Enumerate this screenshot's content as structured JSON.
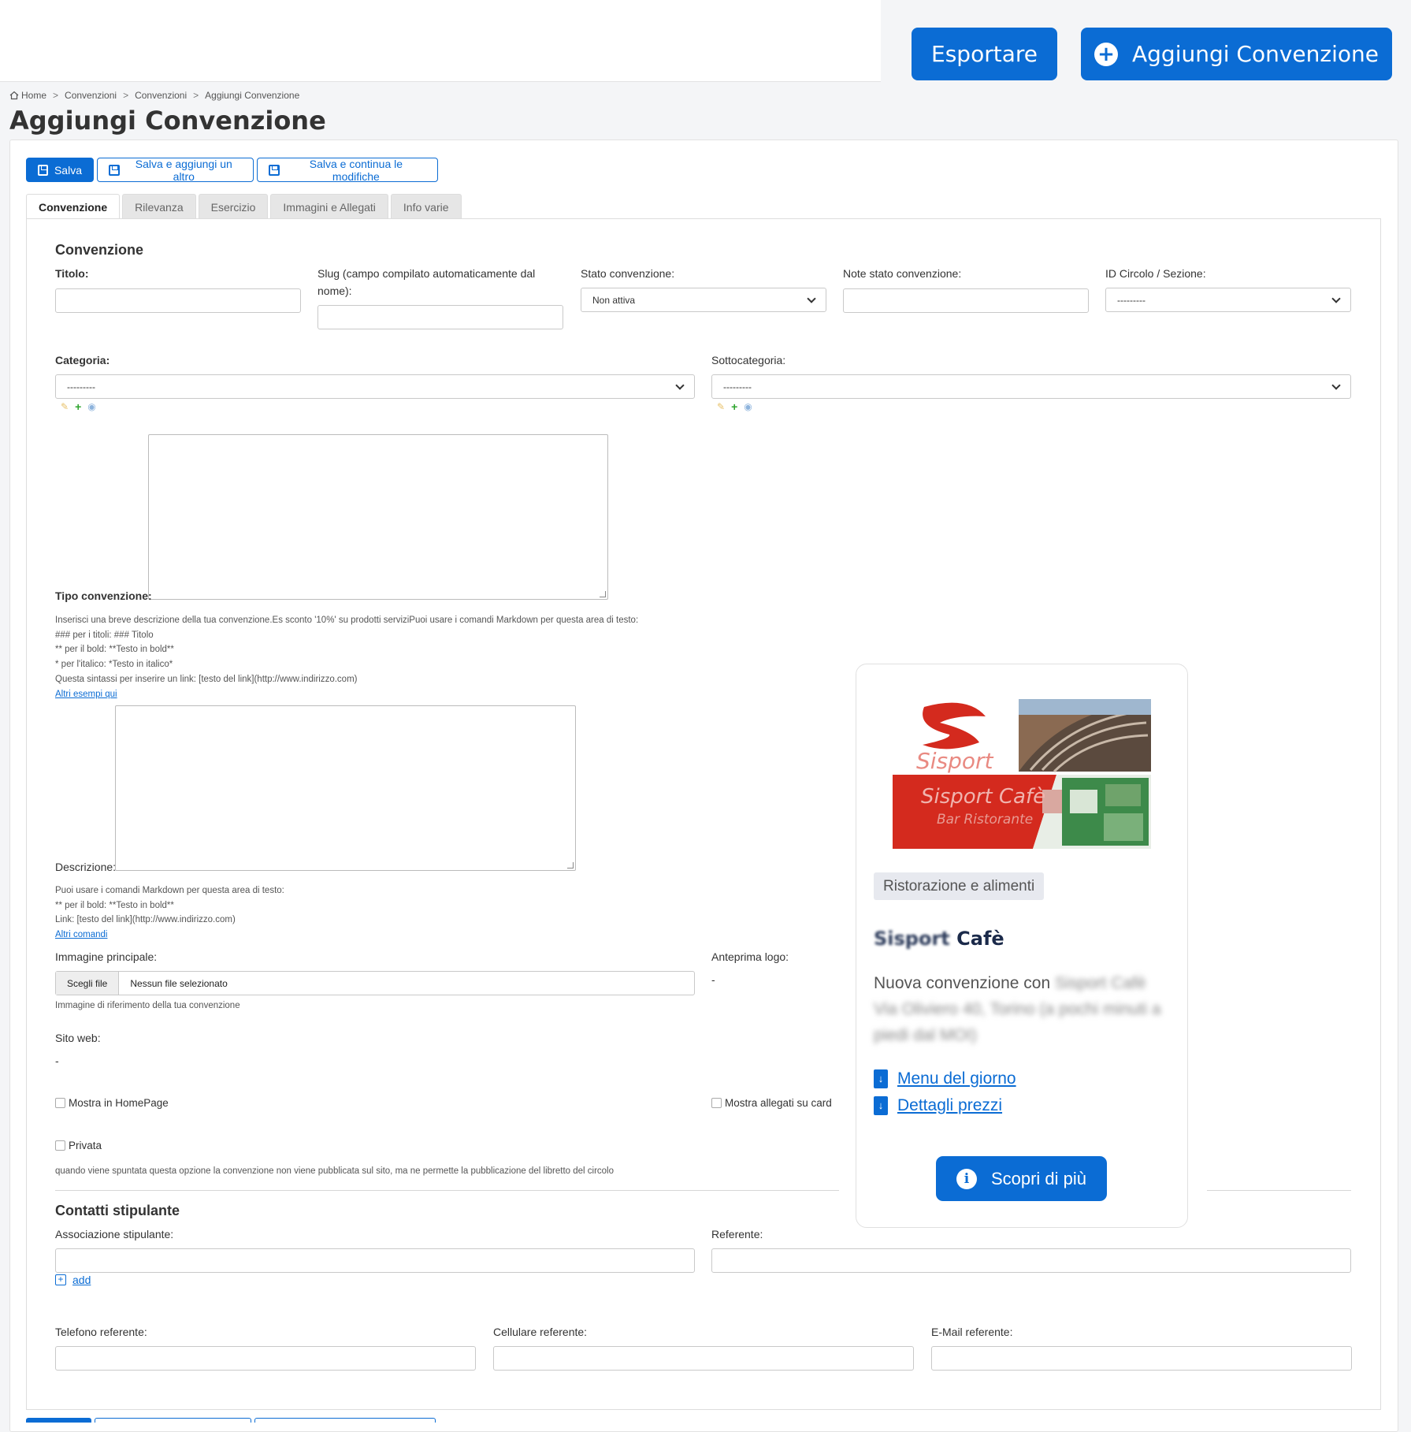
{
  "header": {
    "export_label": "Esportare",
    "add_label": "Aggiungi Convenzione"
  },
  "breadcrumb": {
    "home": "Home",
    "items": [
      "Convenzioni",
      "Convenzioni",
      "Aggiungi Convenzione"
    ],
    "separator": ">"
  },
  "page_title": "Aggiungi Convenzione",
  "actions": {
    "save": "Salva",
    "save_add": "Salva e aggiungi un altro",
    "save_continue": "Salva e continua le modifiche"
  },
  "tabs": [
    {
      "label": "Convenzione",
      "active": true
    },
    {
      "label": "Rilevanza",
      "active": false
    },
    {
      "label": "Esercizio",
      "active": false
    },
    {
      "label": "Immagini e Allegati",
      "active": false
    },
    {
      "label": "Info varie",
      "active": false
    }
  ],
  "form": {
    "section_title": "Convenzione",
    "titolo_label": "Titolo:",
    "titolo_value": "",
    "slug_label": "Slug (campo compilato automaticamente dal nome):",
    "slug_value": "",
    "stato_label": "Stato convenzione:",
    "stato_value": "Non attiva",
    "note_stato_label": "Note stato convenzione:",
    "note_stato_value": "",
    "id_circolo_label": "ID Circolo / Sezione:",
    "id_circolo_value": "---------",
    "categoria_label": "Categoria:",
    "categoria_value": "---------",
    "sottocategoria_label": "Sottocategoria:",
    "sottocategoria_value": "---------",
    "tipo_label": "Tipo convenzione:",
    "tipo_help": [
      "Inserisci una breve descrizione della tua convenzione.Es sconto '10%' su prodotti serviziPuoi usare i comandi Markdown per questa area di testo:",
      "### per i titoli: ### Titolo",
      "** per il bold: **Testo in bold**",
      "* per l'italico: *Testo in italico*",
      "Questa sintassi per inserire un link: [testo del link](http://www.indirizzo.com)"
    ],
    "tipo_help_link": "Altri esempi qui",
    "descrizione_label": "Descrizione:",
    "descrizione_help": [
      "Puoi usare i comandi Markdown per questa area di testo:",
      "** per il bold: **Testo in bold**",
      "Link: [testo del link](http://www.indirizzo.com)"
    ],
    "descrizione_help_link": "Altri comandi",
    "immagine_label": "Immagine principale:",
    "file_button": "Scegli file",
    "file_none": "Nessun file selezionato",
    "immagine_help": "Immagine di riferimento della tua convenzione",
    "anteprima_label": "Anteprima logo:",
    "anteprima_value": "-",
    "sito_label": "Sito web:",
    "sito_value": "-",
    "mostra_home": "Mostra in HomePage",
    "mostra_allegati": "Mostra allegati su card",
    "privata": "Privata",
    "privata_help": "quando viene spuntata questa opzione la convenzione non viene pubblicata sul sito, ma ne permette la pubblicazione del libretto del circolo"
  },
  "contatti": {
    "section_title": "Contatti stipulante",
    "associazione_label": "Associazione stipulante:",
    "add_label": "add",
    "referente_label": "Referente:",
    "telefono_label": "Telefono referente:",
    "cellulare_label": "Cellulare referente:",
    "email_label": "E-Mail referente:"
  },
  "preview": {
    "badge": "Ristorazione e alimenti",
    "title_blur": "Sisport",
    "title_rest": "Cafè",
    "desc_start": "Nuova convenzione con ",
    "desc_blur": "Sisport Cafè Via Oliviero 40, Torino (a pochi minuti a piedi dal MOI)",
    "links": [
      "Menu del giorno",
      "Dettagli prezzi"
    ],
    "cta": "Scopri di più",
    "logo_text_main": "Sisport",
    "logo_text_cafe": "Sisport Cafè",
    "logo_text_sub": "Bar Ristorante"
  },
  "colors": {
    "primary": "#0b6cd4",
    "logo_red": "#d42a1e"
  }
}
